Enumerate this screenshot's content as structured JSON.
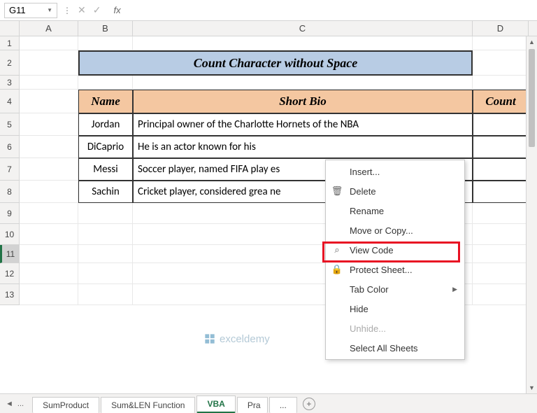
{
  "namebox": "G11",
  "fx_label": "fx",
  "columns": [
    "A",
    "B",
    "C",
    "D"
  ],
  "row_numbers": [
    "1",
    "2",
    "3",
    "4",
    "5",
    "6",
    "7",
    "8",
    "9",
    "10",
    "11",
    "12",
    "13"
  ],
  "active_row": "11",
  "title": "Count Character without Space",
  "headers": {
    "name": "Name",
    "bio": "Short Bio",
    "count": "Count"
  },
  "rows": [
    {
      "name": "Jordan",
      "bio": "Principal owner of the Charlotte Hornets of the NBA"
    },
    {
      "name": "DiCaprio",
      "bio": "He is an actor known for his"
    },
    {
      "name": "Messi",
      "bio": "Soccer player, named FIFA play                                 es"
    },
    {
      "name": "Sachin",
      "bio": "Cricket player, considered grea                                  ne"
    }
  ],
  "context_menu": {
    "insert": "Insert...",
    "delete": "Delete",
    "rename": "Rename",
    "move": "Move or Copy...",
    "view_code": "View Code",
    "protect": "Protect Sheet...",
    "tab_color": "Tab Color",
    "hide": "Hide",
    "unhide": "Unhide...",
    "select_all": "Select All Sheets"
  },
  "tabs": {
    "nav_prev": "◄",
    "nav_more": "...",
    "sum_product": "SumProduct",
    "sum_len": "Sum&LEN Function",
    "vba": "VBA",
    "pra": "Pra",
    "more": "..."
  },
  "watermark": "exceldemy"
}
